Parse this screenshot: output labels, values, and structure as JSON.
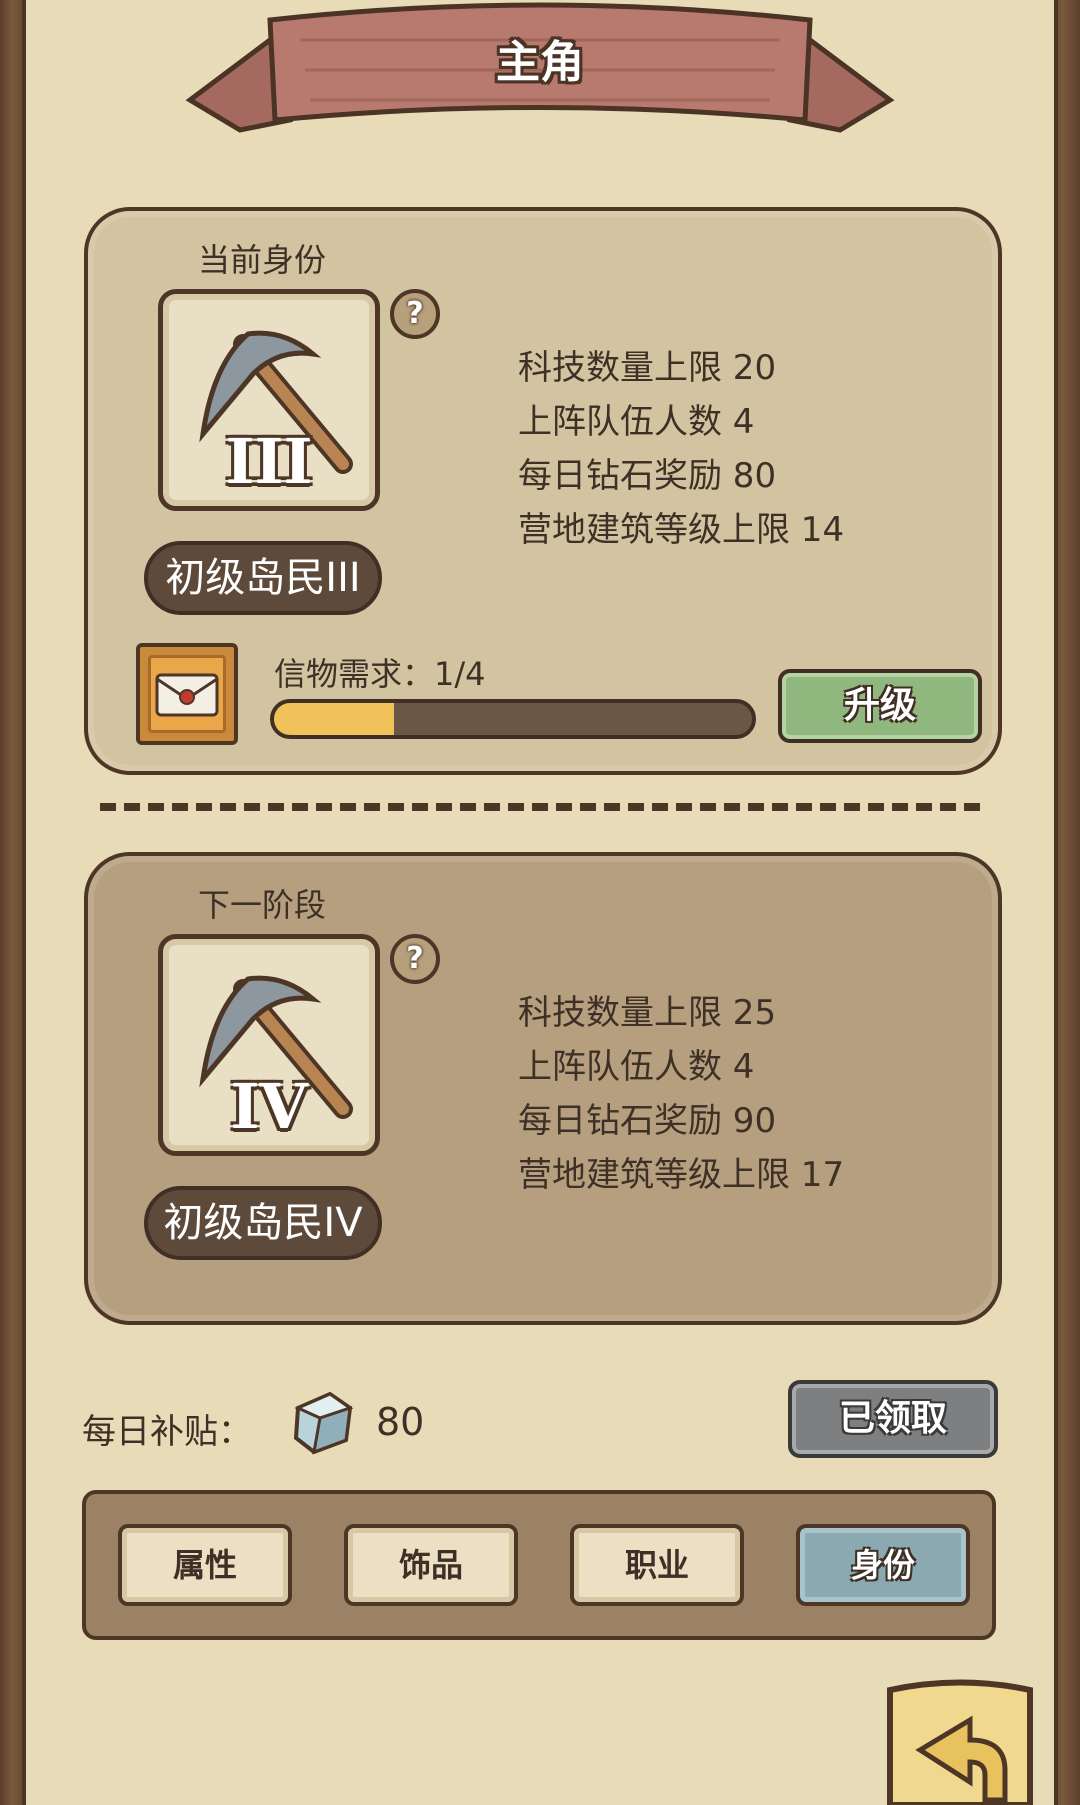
{
  "title": "主角",
  "current": {
    "section_label": "当前身份",
    "icon": "pickaxe-icon",
    "rank_numeral": "III",
    "rank_name": "初级岛民III",
    "help": "?",
    "stats": [
      "科技数量上限 20",
      "上阵队伍人数 4",
      "每日钻石奖励 80",
      "营地建筑等级上限 14"
    ],
    "requirement_label": "信物需求：1/4",
    "requirement_progress": 0.25,
    "upgrade_label": "升级"
  },
  "next": {
    "section_label": "下一阶段",
    "icon": "pickaxe-icon",
    "rank_numeral": "IV",
    "rank_name": "初级岛民IV",
    "help": "?",
    "stats": [
      "科技数量上限 25",
      "上阵队伍人数 4",
      "每日钻石奖励 90",
      "营地建筑等级上限 17"
    ]
  },
  "daily": {
    "label": "每日补贴：",
    "icon": "diamond-icon",
    "amount": "80",
    "claimed_label": "已领取"
  },
  "tabs": [
    {
      "label": "属性",
      "active": false
    },
    {
      "label": "饰品",
      "active": false
    },
    {
      "label": "职业",
      "active": false
    },
    {
      "label": "身份",
      "active": true
    }
  ],
  "colors": {
    "paper": "#e7dcb7",
    "banner": "#b87a6e",
    "progress_fill": "#f2c25a",
    "upgrade_green": "#8fb77e",
    "active_tab": "#8aa9b1"
  }
}
